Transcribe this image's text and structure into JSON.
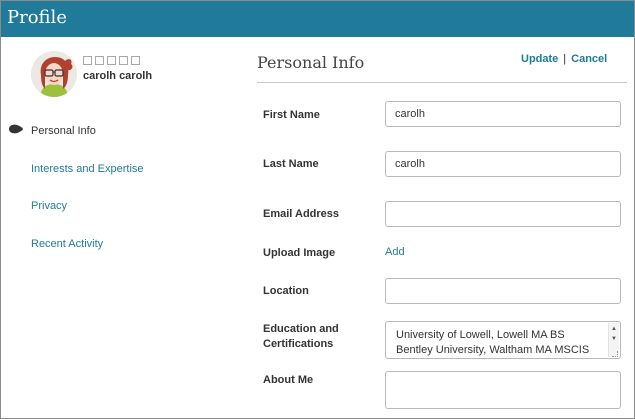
{
  "header": {
    "title": "Profile"
  },
  "profile": {
    "username": "carolh carolh",
    "rating_stars": 5
  },
  "sidebar": {
    "items": [
      {
        "label": "Personal Info",
        "active": true
      },
      {
        "label": "Interests and Expertise",
        "active": false
      },
      {
        "label": "Privacy",
        "active": false
      },
      {
        "label": "Recent Activity",
        "active": false
      }
    ]
  },
  "main": {
    "title": "Personal Info",
    "update_label": "Update",
    "separator": "|",
    "cancel_label": "Cancel",
    "fields": {
      "first_name": {
        "label": "First Name",
        "value": "carolh"
      },
      "last_name": {
        "label": "Last Name",
        "value": "carolh"
      },
      "email": {
        "label": "Email Address",
        "value": ""
      },
      "upload_image": {
        "label": "Upload Image",
        "link": "Add"
      },
      "location": {
        "label": "Location",
        "value": ""
      },
      "education": {
        "label": "Education and Certifications",
        "label_line1": "Education and",
        "label_line2": "Certifications",
        "lines": [
          "University of Lowell, Lowell MA BS",
          "Bentley University, Waltham MA MSCIS"
        ]
      },
      "about_me": {
        "label": "About Me",
        "value": ""
      }
    }
  },
  "colors": {
    "header_bg": "#1f7b99",
    "link": "#1f7b99"
  }
}
